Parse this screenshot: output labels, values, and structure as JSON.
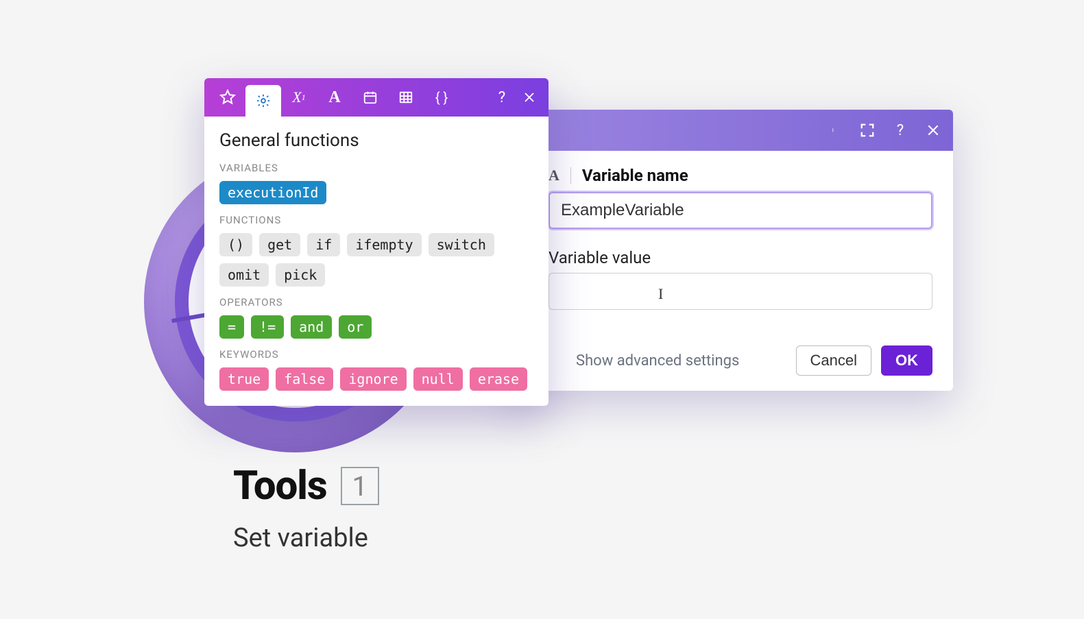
{
  "node": {
    "title": "Tools",
    "count": "1",
    "subtitle": "Set variable"
  },
  "config_modal": {
    "header_title": "ls",
    "variable_name_section_prefix": "A",
    "variable_name_label": "Variable name",
    "variable_name_value": "ExampleVariable",
    "variable_value_label": "Variable value",
    "variable_value_value": "",
    "advanced_label": "Show advanced settings",
    "cancel_label": "Cancel",
    "ok_label": "OK"
  },
  "fn_panel": {
    "title": "General functions",
    "sections": {
      "variables": {
        "label": "VARIABLES",
        "items": [
          "executionId"
        ]
      },
      "functions": {
        "label": "FUNCTIONS",
        "items": [
          "()",
          "get",
          "if",
          "ifempty",
          "switch",
          "omit",
          "pick"
        ]
      },
      "operators": {
        "label": "OPERATORS",
        "items": [
          "=",
          "!=",
          "and",
          "or"
        ]
      },
      "keywords": {
        "label": "KEYWORDS",
        "items": [
          "true",
          "false",
          "ignore",
          "null",
          "erase"
        ]
      }
    },
    "tabs": [
      "star",
      "gear",
      "math",
      "text",
      "date",
      "table",
      "braces"
    ],
    "active_tab": "gear"
  }
}
